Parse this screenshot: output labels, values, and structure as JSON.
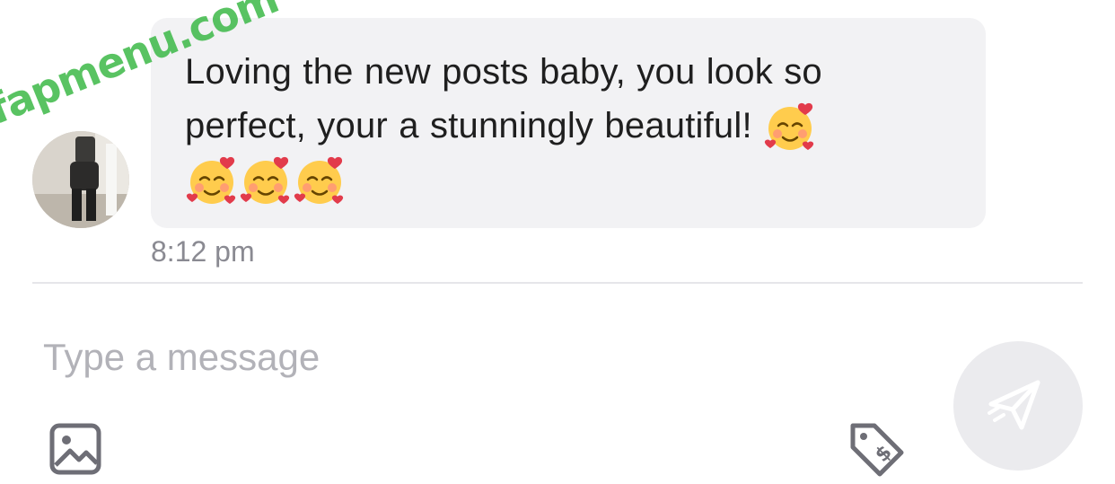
{
  "message": {
    "text_line1": "Loving the new posts baby, you look so",
    "text_line2": "perfect, your a stunningly beautiful!",
    "emojis": [
      "smiling-face-with-hearts",
      "smiling-face-with-hearts",
      "smiling-face-with-hearts",
      "smiling-face-with-hearts"
    ],
    "timestamp": "8:12 pm"
  },
  "watermark": "fapmenu.com",
  "composer": {
    "placeholder": "Type a message",
    "icons": [
      "image-icon",
      "price-tag-icon",
      "send-icon"
    ]
  },
  "colors": {
    "bubble_bg": "#f2f2f4",
    "text": "#1f1f1f",
    "muted": "#8a8a92",
    "placeholder": "#b2b2b8",
    "send_bg": "#ebebee",
    "icon": "#6e6e76",
    "watermark": "#3cb946"
  }
}
